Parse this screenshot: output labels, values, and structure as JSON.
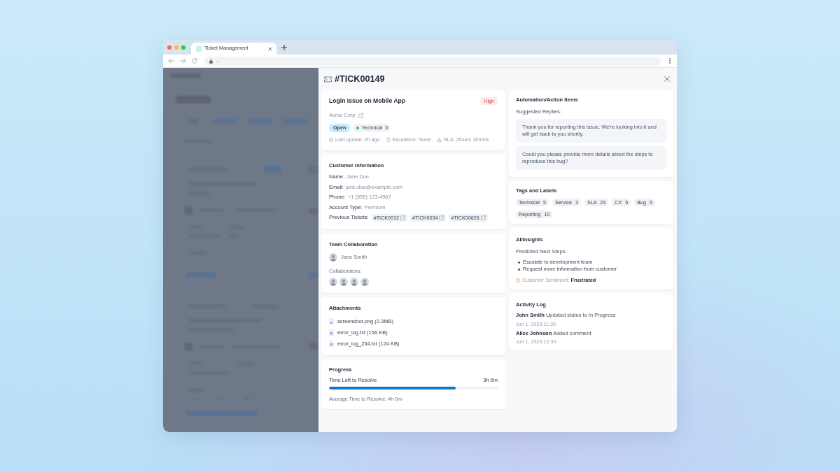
{
  "browser": {
    "tabs": [
      {
        "title": "Ticket Management",
        "selected": true
      }
    ],
    "address": "-"
  },
  "ticket": {
    "id": "#TICK00149"
  },
  "summary": {
    "title": "Login Issue on Mobile App",
    "priority": "High",
    "company": "Acme Corp",
    "status": "Open",
    "category": {
      "label": "Technical",
      "count": "5"
    },
    "meta": [
      {
        "kind": "clock",
        "text": "Last update: 2h ago"
      },
      {
        "kind": "timer",
        "text": "Escalation: None"
      },
      {
        "kind": "warning",
        "text": "SLA: 2hours 30mins"
      }
    ]
  },
  "customer": {
    "title": "Customer information",
    "fields": [
      {
        "label": "Name:",
        "value": "Jane Doe"
      },
      {
        "label": "Email:",
        "value": "jane.doe@example.com"
      },
      {
        "label": "Phone:",
        "value": "+1 (555) 123-4567"
      },
      {
        "label": "Account Type:",
        "value": "Premium"
      }
    ],
    "previous_tickets": {
      "label": "Previous Tickets:",
      "items": [
        "#TICK0012",
        "#TICK0034",
        "#TICK00626"
      ]
    }
  },
  "team": {
    "title": "Team Collaboration",
    "assignee": "Jane Smith",
    "collaborators_label": "Collaborators:",
    "collaborators": [
      {
        "kind": "photo"
      },
      {
        "kind": "photo"
      },
      {
        "kind": "photo"
      },
      {
        "kind": "photo"
      }
    ]
  },
  "attachments": {
    "title": "Attachments",
    "files": [
      {
        "kind": "image",
        "name": "screenshot.png (2.3MB)"
      },
      {
        "kind": "text",
        "name": "error_log.txt (156 KB)"
      },
      {
        "kind": "text",
        "name": "error_log_234.txt (124 KB)"
      }
    ]
  },
  "progress": {
    "title": "Progress",
    "label": "Time Left to Resolve",
    "reading": "3h 0m",
    "level": 0.75,
    "note": "Average Time to Resolve: 4h 0m"
  },
  "automation": {
    "title": "Automation/Action Items",
    "subtitle": "Suggested Replies:",
    "replies": [
      "Thank you for reporting this issue. We're looking into it and will get back to you shortly.",
      "Could you please provide more details about the steps to reproduce this bug?"
    ]
  },
  "tags": {
    "title": "Tags and Labels",
    "items": [
      {
        "label": "Technical",
        "count": "5"
      },
      {
        "label": "Service",
        "count": "3"
      },
      {
        "label": "SLA",
        "count": "23"
      },
      {
        "label": "CX",
        "count": "5"
      },
      {
        "label": "Bug",
        "count": "5"
      },
      {
        "label": "Reporting",
        "count": "10"
      }
    ]
  },
  "insights": {
    "title": "AI/Insights",
    "subtitle": "Predicted Next Steps:",
    "steps": [
      "Escalate to development team",
      "Request more information from customer"
    ],
    "sentiment": "Customer Sentiment: **Frustrated**"
  },
  "activity": {
    "title": "Activity Log",
    "entries": [
      {
        "text": "**John Smith** Updated status to In Progress",
        "time": "Jun 1, 2023 11:30"
      },
      {
        "text": "**Alice Johnson** Added comment",
        "time": "Jun 1, 2023 12:30"
      }
    ]
  }
}
